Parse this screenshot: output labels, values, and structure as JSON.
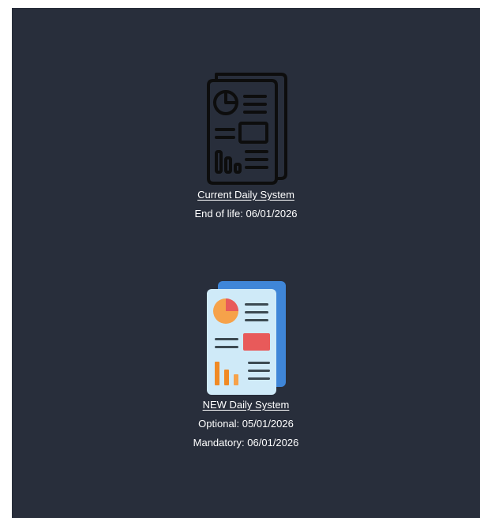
{
  "systems": [
    {
      "icon": "report-document-icon",
      "link_label": "Current Daily System",
      "details": [
        "End of life: 06/01/2026"
      ]
    },
    {
      "icon": "colored-report-document-icon",
      "link_label": "NEW Daily System",
      "details": [
        "Optional: 05/01/2026",
        "Mandatory: 06/01/2026"
      ]
    }
  ],
  "colors": {
    "background": "#282e3b",
    "text": "#ffffff",
    "new_icon_page": "#cfeaf8",
    "new_icon_back": "#3f86d8",
    "new_icon_accent_orange": "#f6a24a",
    "new_icon_accent_red": "#e85a5a"
  }
}
